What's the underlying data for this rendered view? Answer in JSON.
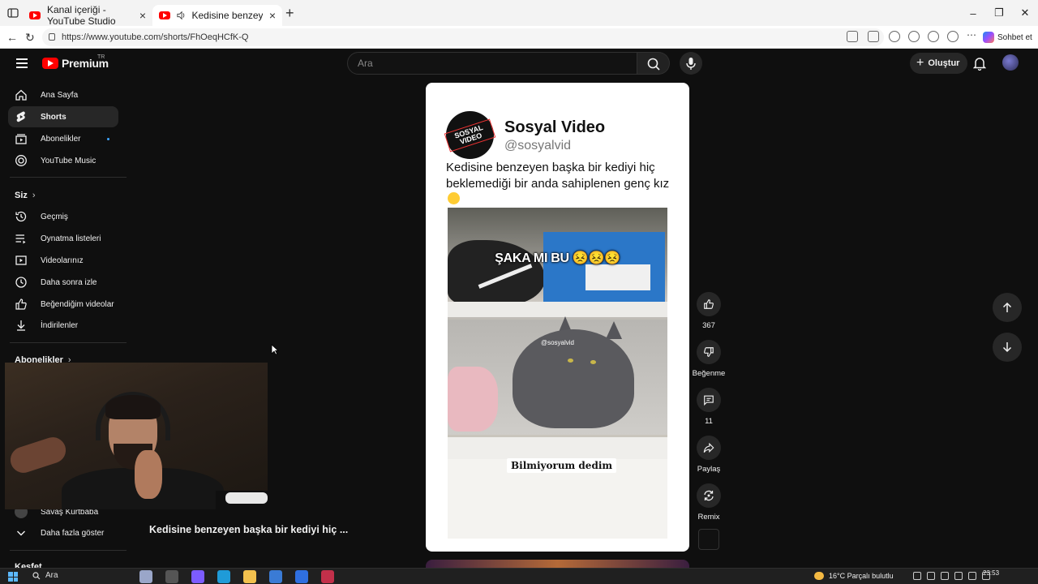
{
  "browser": {
    "tabs": [
      {
        "label": "Kanal içeriği - YouTube Studio"
      },
      {
        "label": "Kedisine benzeyen başka bir"
      }
    ],
    "url": "https://www.youtube.com/shorts/FhOeqHCfK-Q",
    "copilot_label": "Sohbet et"
  },
  "header": {
    "brand": "Premium",
    "region": "TR",
    "search_placeholder": "Ara",
    "create_label": "Oluştur"
  },
  "sidebar": {
    "main": [
      {
        "label": "Ana Sayfa",
        "icon": "home-icon"
      },
      {
        "label": "Shorts",
        "icon": "shorts-icon"
      },
      {
        "label": "Abonelikler",
        "icon": "subscriptions-icon"
      },
      {
        "label": "YouTube Music",
        "icon": "music-icon"
      }
    ],
    "you_title": "Siz",
    "you": [
      {
        "label": "Geçmiş",
        "icon": "history-icon"
      },
      {
        "label": "Oynatma listeleri",
        "icon": "playlists-icon"
      },
      {
        "label": "Videolarınız",
        "icon": "your-videos-icon"
      },
      {
        "label": "Daha sonra izle",
        "icon": "watch-later-icon"
      },
      {
        "label": "Beğendiğim videolar",
        "icon": "liked-icon"
      },
      {
        "label": "İndirilenler",
        "icon": "downloads-icon"
      }
    ],
    "subs_title": "Abonelikler",
    "channel": "Savaş Kurtbaba",
    "show_more": "Daha fazla göster",
    "explore_title": "Keşfet"
  },
  "video": {
    "title_overlay": "Kedisine benzeyen başka bir kediyi hiç ...",
    "card_name": "Sosyal Video",
    "card_handle": "@sosyalvid",
    "card_logo_text": "SOSYAL VIDEO",
    "caption": "Kedisine benzeyen başka bir kediyi hiç beklemediği bir anda sahiplenen genç kız",
    "overlay_top": "ŞAKA MI BU 😣😣😣",
    "watermark": "@sosyalvid",
    "overlay_bottom": "Bilmiyorum dedim"
  },
  "actions": {
    "likes": "367",
    "dislike": "Beğenme",
    "comments": "11",
    "share": "Paylaş",
    "remix": "Remix"
  },
  "taskbar": {
    "search": "Ara",
    "weather": "16°C  Parçalı bulutlu",
    "time": "23:53"
  }
}
